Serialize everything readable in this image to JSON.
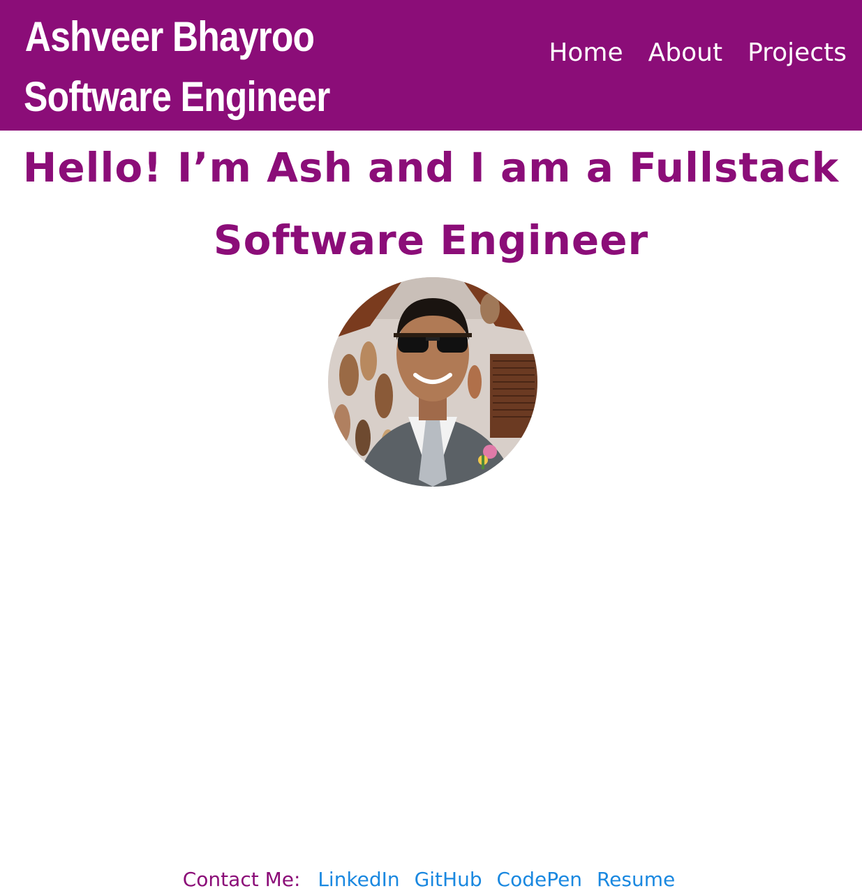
{
  "colors": {
    "brand_purple": "#8b0d78",
    "link_blue": "#1a88e0",
    "background": "#ffffff"
  },
  "header": {
    "name": "Ashveer Bhayroo",
    "role": "Software Engineer",
    "nav": [
      {
        "label": "Home"
      },
      {
        "label": "About"
      },
      {
        "label": "Projects"
      }
    ]
  },
  "hero": {
    "heading": "Hello! I’m Ash and I am a Fullstack Software Engineer"
  },
  "avatar": {
    "icon": "profile-photo"
  },
  "footer": {
    "contact_label": "Contact Me:",
    "links": [
      {
        "label": "LinkedIn"
      },
      {
        "label": "GitHub"
      },
      {
        "label": "CodePen"
      },
      {
        "label": "Resume"
      }
    ]
  }
}
